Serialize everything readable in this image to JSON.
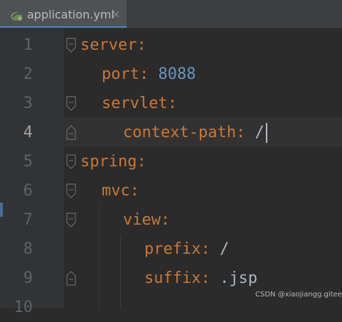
{
  "tab": {
    "title": "application.yml",
    "close_glyph": "×",
    "icon": "yaml-file-icon"
  },
  "editor": {
    "current_line": 4,
    "lines": [
      {
        "num": "1",
        "indent": 0,
        "key": "server",
        "colon": ":",
        "value": "",
        "value_type": ""
      },
      {
        "num": "2",
        "indent": 1,
        "key": "port",
        "colon": ":",
        "value": " 8088",
        "value_type": "number"
      },
      {
        "num": "3",
        "indent": 1,
        "key": "servlet",
        "colon": ":",
        "value": "",
        "value_type": ""
      },
      {
        "num": "4",
        "indent": 2,
        "key": "context-path",
        "colon": ":",
        "value": " /",
        "value_type": "string"
      },
      {
        "num": "5",
        "indent": 0,
        "key": "spring",
        "colon": ":",
        "value": "",
        "value_type": ""
      },
      {
        "num": "6",
        "indent": 1,
        "key": "mvc",
        "colon": ":",
        "value": "",
        "value_type": ""
      },
      {
        "num": "7",
        "indent": 2,
        "key": "view",
        "colon": ":",
        "value": "",
        "value_type": ""
      },
      {
        "num": "8",
        "indent": 3,
        "key": "prefix",
        "colon": ":",
        "value": " /",
        "value_type": "string"
      },
      {
        "num": "9",
        "indent": 3,
        "key": "suffix",
        "colon": ":",
        "value": " .jsp",
        "value_type": "string"
      },
      {
        "num": "10",
        "indent": 0,
        "key": "",
        "colon": "",
        "value": "",
        "value_type": ""
      }
    ]
  },
  "colors": {
    "background": "#2b2b2b",
    "gutter": "#313335",
    "key": "#cc7832",
    "number": "#6897bb",
    "text": "#a9b7c6",
    "tab_underline": "#4a88c7"
  },
  "watermark": "CSDN @xiaojiangg.gitee.io"
}
